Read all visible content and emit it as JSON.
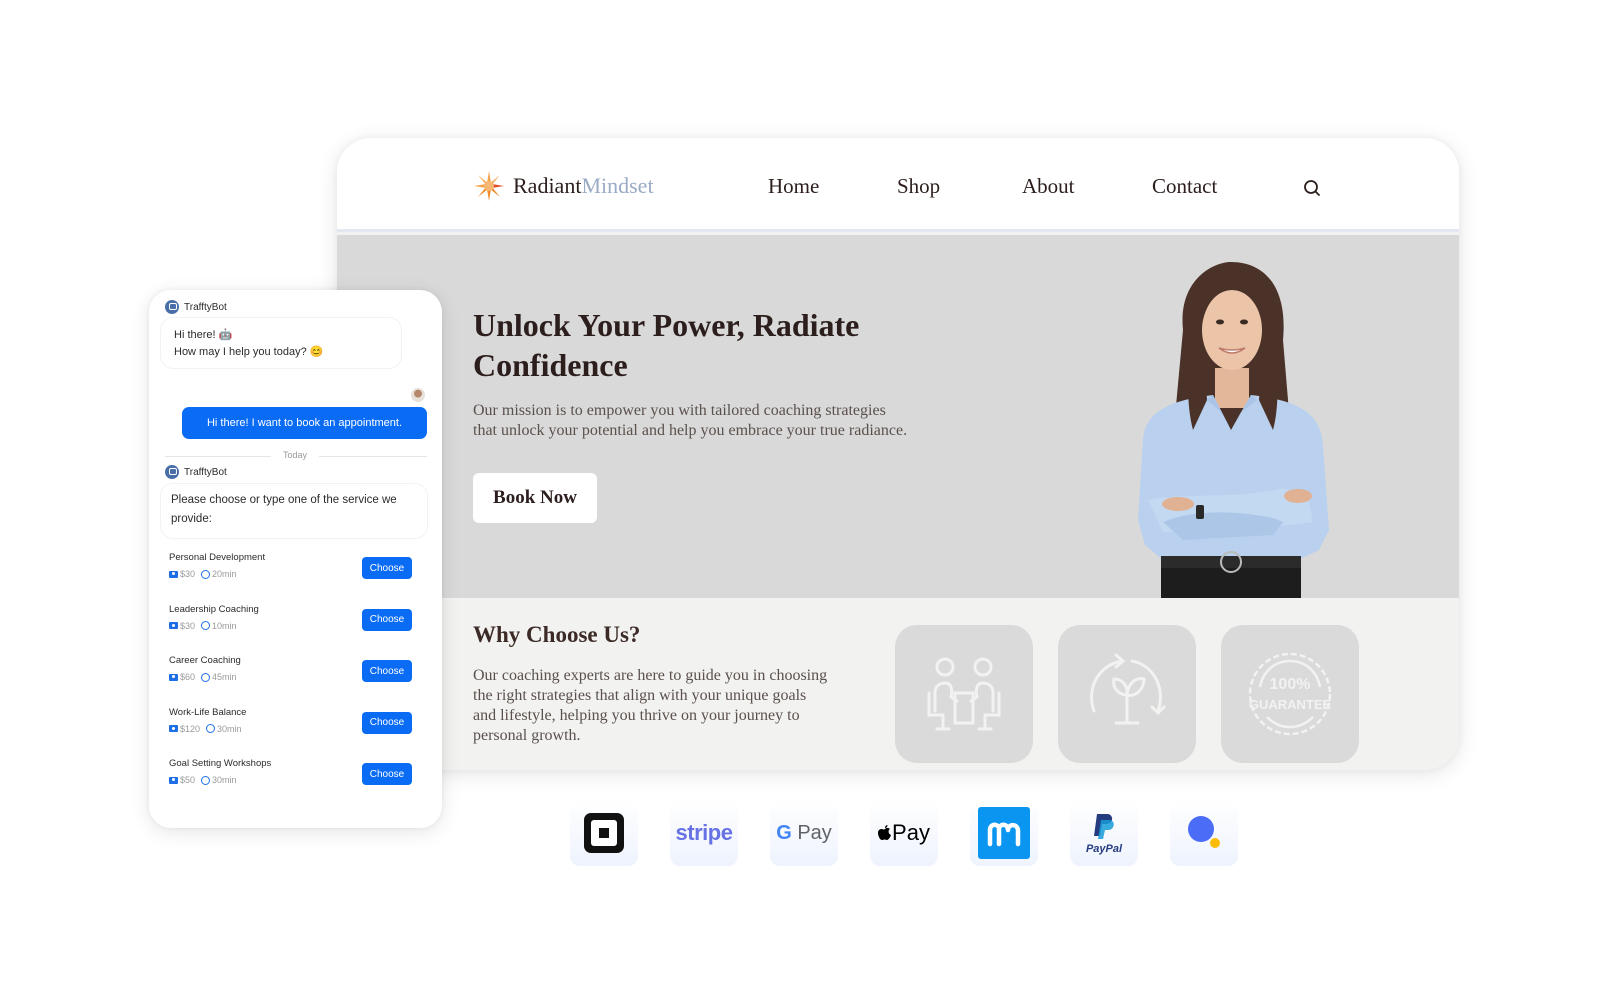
{
  "site": {
    "logo": {
      "icon": "sunburst-icon",
      "name_primary": "Radiant",
      "name_accent": "Mindset"
    },
    "nav": [
      {
        "label": "Home"
      },
      {
        "label": "Shop"
      },
      {
        "label": "About"
      },
      {
        "label": "Contact"
      }
    ],
    "search_icon": "search-icon",
    "hero": {
      "title": "Unlock Your Power, Radiate Confidence",
      "description": "Our mission is to empower you with tailored coaching strategies that unlock your potential and help you embrace your true radiance.",
      "cta_label": "Book Now",
      "image": "smiling-woman-portrait"
    },
    "why": {
      "title": "Why Choose Us?",
      "description": "Our coaching experts are here to guide you in choosing the right strategies that align with your unique goals and lifestyle, helping you thrive on your journey to personal growth.",
      "features": [
        {
          "icon": "meeting-people-icon"
        },
        {
          "icon": "growth-cycle-plant-icon"
        },
        {
          "icon": "guarantee-badge-icon",
          "badge_line1": "100%",
          "badge_line2": "GUARANTEE"
        }
      ]
    }
  },
  "chat": {
    "bot_name": "TrafftyBot",
    "greeting_line1": "Hi there! 🤖",
    "greeting_line2": "How may I help you today? 😊",
    "user_message": "Hi there! I want to book an appointment.",
    "divider_label": "Today",
    "prompt": "Please choose or type one of the service we provide:",
    "choose_label": "Choose",
    "services": [
      {
        "name": "Personal Development",
        "price": "$30",
        "duration": "20min"
      },
      {
        "name": "Leadership Coaching",
        "price": "$30",
        "duration": "10min"
      },
      {
        "name": "Career Coaching",
        "price": "$60",
        "duration": "45min"
      },
      {
        "name": "Work-Life Balance",
        "price": "$120",
        "duration": "30min"
      },
      {
        "name": "Goal Setting Workshops",
        "price": "$50",
        "duration": "30min"
      }
    ]
  },
  "payments": [
    {
      "name": "Square",
      "icon": "square-logo-icon"
    },
    {
      "name": "stripe",
      "icon": "stripe-logo-icon"
    },
    {
      "name": "G Pay",
      "icon": "google-pay-logo-icon"
    },
    {
      "name": "Pay",
      "icon": "apple-pay-logo-icon"
    },
    {
      "name": "m",
      "icon": "mollie-logo-icon"
    },
    {
      "name": "PayPal",
      "icon": "paypal-logo-icon"
    },
    {
      "name": "Dot",
      "icon": "blue-dot-logo-icon"
    }
  ],
  "colors": {
    "accent_blue": "#0a6cf5",
    "logo_accent": "#9aabc6",
    "hero_bg": "#d9d9d9",
    "text_dark": "#2b1e1c"
  }
}
